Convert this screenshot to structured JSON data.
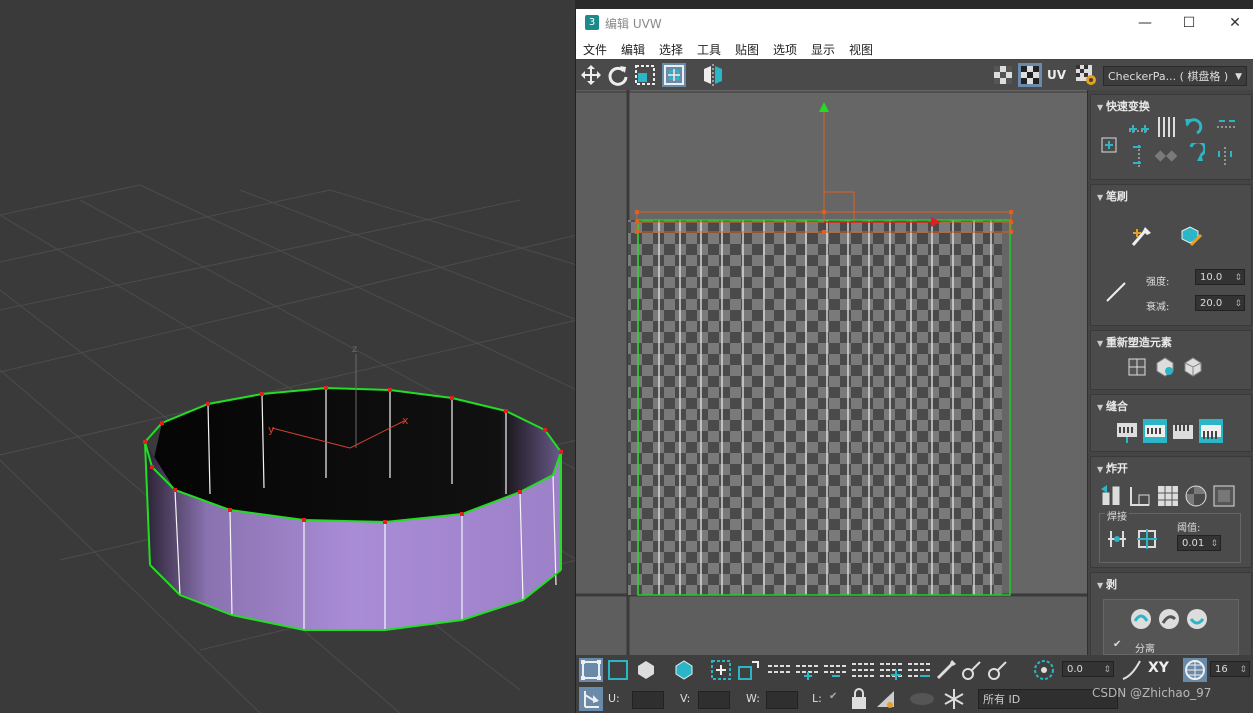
{
  "window": {
    "title": "编辑 UVW",
    "app_icon_text": "3",
    "minimize": "—",
    "maximize": "☐",
    "close": "✕"
  },
  "menu": [
    "文件",
    "编辑",
    "选择",
    "工具",
    "贴图",
    "选项",
    "显示",
    "视图"
  ],
  "toolbar": {
    "uv_label": "UV",
    "texture_dropdown": "CheckerPa... ( 棋盘格 )"
  },
  "viewport": {
    "axis_x": "x",
    "axis_y": "y",
    "axis_z": "z",
    "mesh_fill": "#a98cd6",
    "edge_color": "#22dd22",
    "vertex_color": "#e02020"
  },
  "side_panel": {
    "quick_transform": {
      "title": "快速变换"
    },
    "brush": {
      "title": "笔刷",
      "strength_label": "强度:",
      "strength_value": "10.0",
      "falloff_label": "衰减:",
      "falloff_value": "20.0"
    },
    "reshape": {
      "title": "重新塑造元素"
    },
    "stitch": {
      "title": "缝合"
    },
    "explode": {
      "title": "炸开",
      "weld_label": "焊接",
      "threshold_label": "阈值:",
      "threshold_value": "0.01"
    },
    "peel": {
      "title": "剥",
      "detach_label": "分离"
    }
  },
  "bottom": {
    "angle_value": "0.0",
    "xy_label": "XY",
    "grid_value": "16",
    "u_label": "U:",
    "v_label": "V:",
    "w_label": "W:",
    "l_label": "L:",
    "id_dropdown": "所有 ID"
  },
  "watermark": "CSDN @Zhichao_97"
}
